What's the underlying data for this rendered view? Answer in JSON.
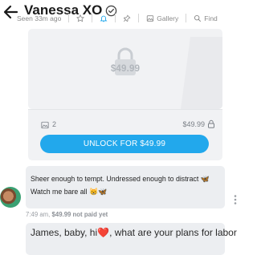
{
  "header": {
    "title": "Vanessa XO",
    "status": "Seen 33m ago",
    "gallery_label": "Gallery",
    "find_label": "Find"
  },
  "locked_post": {
    "price_overlay": "$49.99",
    "media_count": "2",
    "price": "$49.99",
    "unlock_label": "UNLOCK FOR $49.99"
  },
  "message": {
    "text": "Sheer enough to tempt. Undressed enough to distract ",
    "text_after_emoji": " Watch me bare all ",
    "time": "7:49 am,",
    "payment_status": "$49.99 not paid yet"
  },
  "next_message": {
    "text_line1": "James, baby, hi❤️, what are your plans for labor",
    "text_line2": "… (partially visible)"
  },
  "colors": {
    "accent": "#22a8ec",
    "card_bg": "#f1f2f4",
    "bubble_bg": "#eceef1",
    "muted_text": "#8a8a8a"
  }
}
